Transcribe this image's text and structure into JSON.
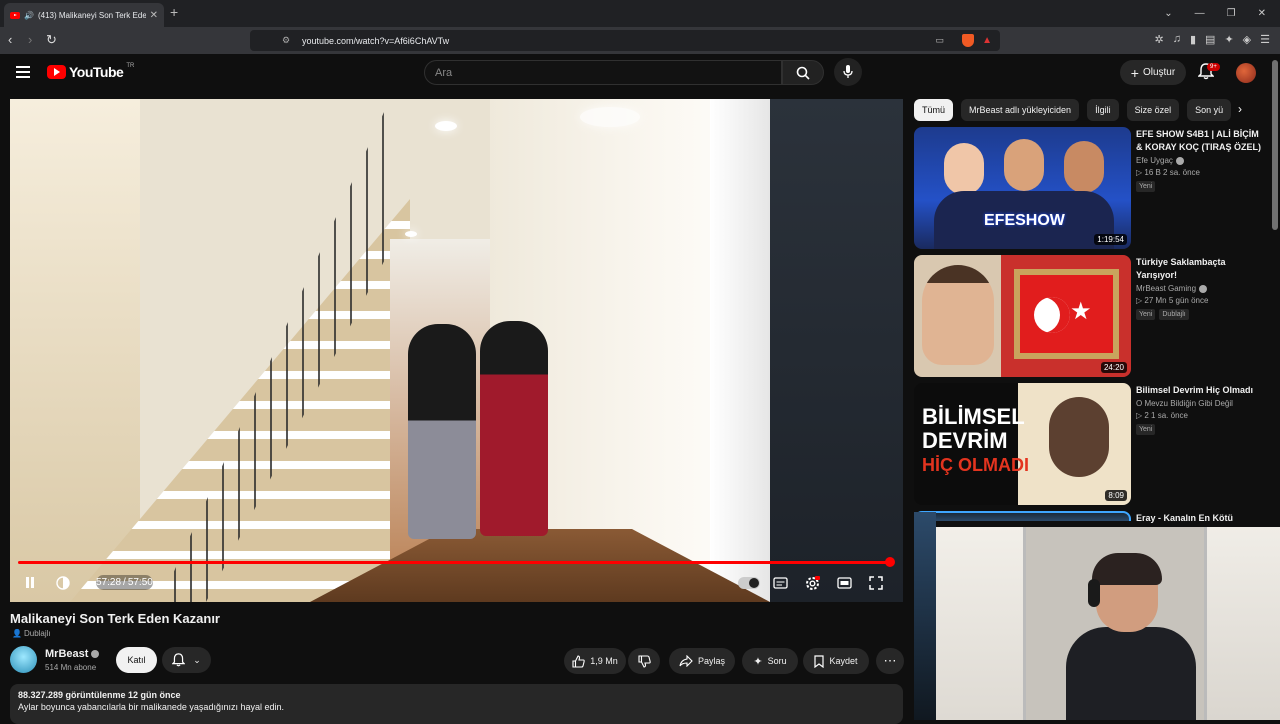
{
  "browser": {
    "tab_title": "(413) Malikaneyi Son Terk Ede",
    "url": "youtube.com/watch?v=Af6i6ChAVTw"
  },
  "header": {
    "logo_text": "YouTube",
    "logo_region": "TR",
    "search_placeholder": "Ara",
    "create_label": "Oluştur",
    "notification_count": "9+"
  },
  "player": {
    "current_time": "57:28",
    "separator": "/",
    "duration": "57:50",
    "progress": 0.994
  },
  "video": {
    "title": "Malikaneyi Son Terk Eden Kazanır",
    "dub_label": "Dublajlı",
    "channel": "MrBeast",
    "subscribers": "514 Mn abone",
    "join_label": "Katıl",
    "likes": "1,9 Mn",
    "share_label": "Paylaş",
    "ask_label": "Soru",
    "save_label": "Kaydet",
    "stats": "88.327.289 görüntülenme  12 gün önce",
    "description": "Aylar boyunca yabancılarla bir malikanede yaşadığınızı hayal edin."
  },
  "chips": [
    "Tümü",
    "MrBeast adlı yükleyiciden",
    "İlgili",
    "Size özel",
    "Son yü"
  ],
  "recommendations": [
    {
      "title": "EFE SHOW S4B1 | ALİ BİÇİM & KORAY KOÇ (TIRAŞ ÖZEL)",
      "channel": "Efe Uygaç",
      "meta": "▷ 16 B  2 sa. önce",
      "badge": "Yeni",
      "duration": "1:19:54",
      "thumb_text": "EFESHOW"
    },
    {
      "title": "Türkiye Saklambaçta Yarışıyor!",
      "channel": "MrBeast Gaming",
      "meta": "▷ 27 Mn  5 gün önce",
      "badge": "Yeni",
      "badge2": "Dublajlı",
      "duration": "24:20"
    },
    {
      "title": "Bilimsel Devrim Hiç Olmadı",
      "channel": "O Mevzu Bildiğin Gibi Değil",
      "meta": "▷ 2  1 sa. önce",
      "badge": "Yeni",
      "duration": "8:09",
      "thumb_line1": "BİLİMSEL",
      "thumb_line2": "DEVRİM",
      "thumb_line3": "HİÇ OLMADI"
    },
    {
      "title": "Eray - Kanalın En Kötü"
    }
  ],
  "colors": {
    "accent": "#ff0000",
    "background": "#0f0f0f",
    "surface": "#272727"
  }
}
